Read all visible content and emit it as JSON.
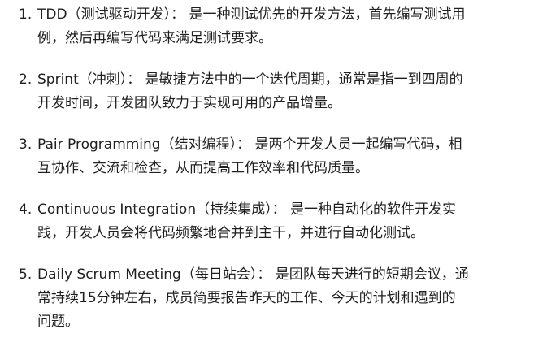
{
  "items": [
    {
      "number": "1.",
      "lines": [
        "TDD（测试驱动开发）： 是一种测试优先的开发方法，首先编写测试用",
        "例，然后再编写代码来满足测试要求。"
      ]
    },
    {
      "number": "2.",
      "lines": [
        "Sprint（冲刺）： 是敏捷方法中的一个迭代周期，通常是指一到四周的",
        "开发时间，开发团队致力于实现可用的产品增量。"
      ]
    },
    {
      "number": "3.",
      "lines": [
        "Pair Programming（结对编程）： 是两个开发人员一起编写代码，相",
        "互协作、交流和检查，从而提高工作效率和代码质量。"
      ]
    },
    {
      "number": "4.",
      "lines": [
        "Continuous Integration（持续集成）： 是一种自动化的软件开发实",
        "践，开发人员会将代码频繁地合并到主干，并进行自动化测试。"
      ]
    },
    {
      "number": "5.",
      "lines": [
        "Daily Scrum Meeting（每日站会）： 是团队每天进行的短期会议，通",
        "常持续15分钟左右，成员简要报告昨天的工作、今天的计划和遇到的",
        "问题。"
      ]
    }
  ]
}
